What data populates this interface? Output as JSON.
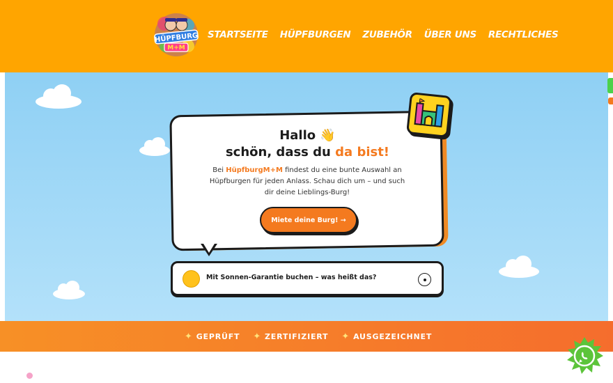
{
  "header": {
    "logo_text_top": "HÜPFBURG",
    "logo_text_bottom": "M+M",
    "nav": [
      "STARTSEITE",
      "HÜPFBURGEN",
      "ZUBEHÖR",
      "ÜBER UNS",
      "RECHTLICHES"
    ]
  },
  "hero": {
    "greeting_line1": "Hallo",
    "greeting_emoji": "👋",
    "greeting_line2_start": "schön, dass du ",
    "greeting_line2_highlight": "da bist!",
    "intro_prefix": "Bei ",
    "intro_brand": "HüpfburgM+M",
    "intro_rest": " findest du eine bunte Auswahl an Hüpfburgen für jeden Anlass. Schau dich um – und such dir deine Lieblings-Burg!",
    "cta_label": "Miete deine Burg! →"
  },
  "faq": {
    "question": "Mit Sonnen-Garantie buchen – was heißt das?"
  },
  "strip": {
    "items": [
      "GEPRÜFT",
      "ZERTIFIZIERT",
      "AUSGEZEICHNET"
    ]
  },
  "colors": {
    "header_bg": "#ffa500",
    "accent_orange": "#f47a1f",
    "sky_top": "#8fd0f4",
    "whatsapp_green": "#5cc43a"
  },
  "icons": {
    "castle": "bouncy-castle-icon",
    "sun": "sun-icon",
    "star": "sparkle-star-icon",
    "whatsapp": "whatsapp-icon"
  }
}
